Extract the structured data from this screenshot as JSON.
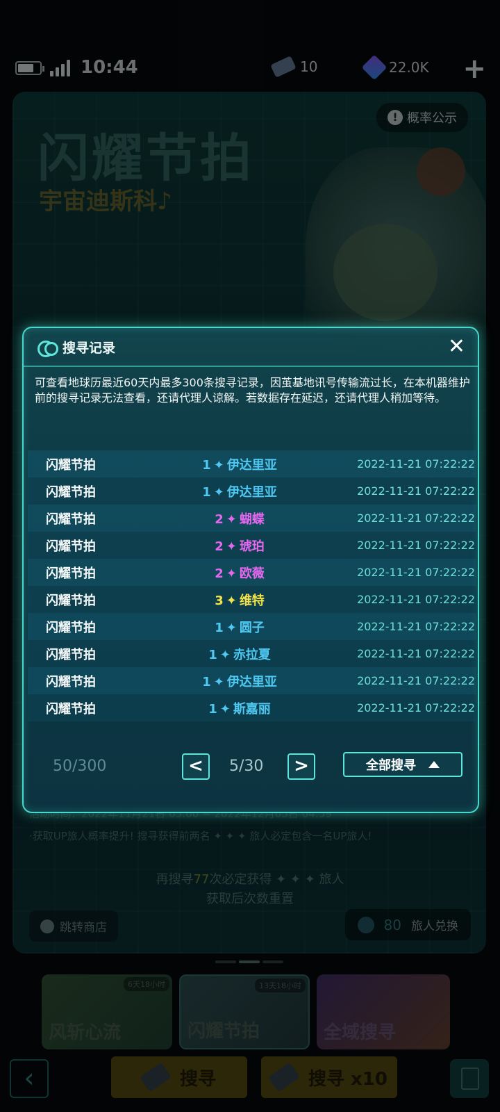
{
  "status": {
    "time": "10:44",
    "tickets": "10",
    "gems": "22.0K"
  },
  "banner": {
    "title": "闪耀节拍",
    "subtitle": "宇宙迪斯科♪",
    "probability_label": "概率公示",
    "period": "活动时间：2022年11月21日 05:00 ~ 2022年12月05日 04:59",
    "rule": "·获取UP旅人概率提升! 搜寻获得前两名 ✦ ✦ ✦ 旅人必定包含一名UP旅人!",
    "pity_line1_prefix": "再搜寻",
    "pity_count": "77",
    "pity_line1_suffix": "次必定获得 ✦ ✦ ✦ 旅人",
    "pity_line2": "获取后次数重置",
    "shop_label": "跳转商店",
    "exchange_count": "80",
    "exchange_label": "旅人兑换"
  },
  "pool_tabs": [
    {
      "label": "风斩心流",
      "timer": "6天18小时"
    },
    {
      "label": "闪耀节拍",
      "timer": "13天18小时"
    },
    {
      "label": "全域搜寻",
      "timer": ""
    }
  ],
  "bottom": {
    "pull_one": "搜寻",
    "pull_ten": "搜寻  x10"
  },
  "dialog": {
    "title": "搜寻记录",
    "description": "可查看地球历最近60天内最多300条搜寻记录，因茧基地讯号传输流过长，在本机器维护前的搜寻记录无法查看，还请代理人谅解。若数据存在延迟，还请代理人稍加等待。",
    "records": [
      {
        "pool": "闪耀节拍",
        "rarity": "1",
        "name": "伊达里亚",
        "color": "#4fc8f2",
        "time": "2022-11-21 07:22:22"
      },
      {
        "pool": "闪耀节拍",
        "rarity": "1",
        "name": "伊达里亚",
        "color": "#4fc8f2",
        "time": "2022-11-21 07:22:22"
      },
      {
        "pool": "闪耀节拍",
        "rarity": "2",
        "name": "蝴蝶",
        "color": "#e468ee",
        "time": "2022-11-21 07:22:22"
      },
      {
        "pool": "闪耀节拍",
        "rarity": "2",
        "name": "琥珀",
        "color": "#e468ee",
        "time": "2022-11-21 07:22:22"
      },
      {
        "pool": "闪耀节拍",
        "rarity": "2",
        "name": "欧薇",
        "color": "#e468ee",
        "time": "2022-11-21 07:22:22"
      },
      {
        "pool": "闪耀节拍",
        "rarity": "3",
        "name": "维特",
        "color": "#f2e34a",
        "time": "2022-11-21 07:22:22"
      },
      {
        "pool": "闪耀节拍",
        "rarity": "1",
        "name": "圆子",
        "color": "#4fc8f2",
        "time": "2022-11-21 07:22:22"
      },
      {
        "pool": "闪耀节拍",
        "rarity": "1",
        "name": "赤拉夏",
        "color": "#4fc8f2",
        "time": "2022-11-21 07:22:22"
      },
      {
        "pool": "闪耀节拍",
        "rarity": "1",
        "name": "伊达里亚",
        "color": "#4fc8f2",
        "time": "2022-11-21 07:22:22"
      },
      {
        "pool": "闪耀节拍",
        "rarity": "1",
        "name": "斯嘉丽",
        "color": "#4fc8f2",
        "time": "2022-11-21 07:22:22"
      }
    ],
    "count": "50/300",
    "page": "5/30",
    "prev": "<",
    "next": ">",
    "filter_label": "全部搜寻"
  }
}
